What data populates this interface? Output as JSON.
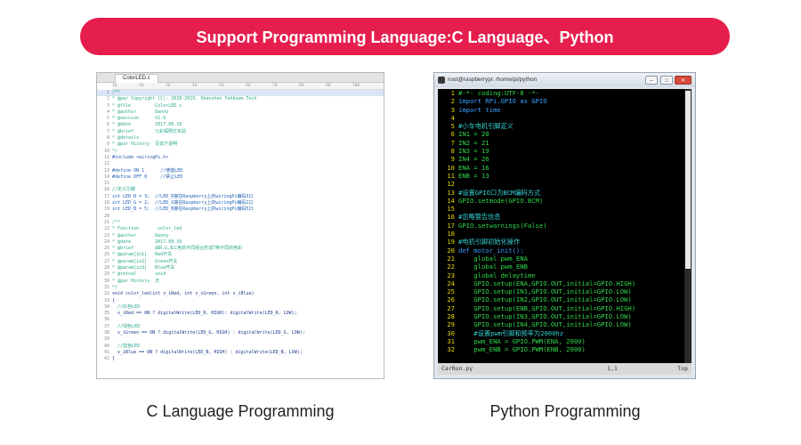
{
  "banner": {
    "title": "Support Programming Language:C Language、Python",
    "color": "#e61e4d"
  },
  "c_editor": {
    "tab": "ColorLED.c",
    "ruler": [
      "10",
      "20",
      "30",
      "40",
      "50",
      "60",
      "70",
      "80",
      "90",
      "100"
    ],
    "lines": [
      {
        "n": "1",
        "t": "/**",
        "type": "comment"
      },
      {
        "n": "2",
        "t": "* @par Copyright (C): 2010-2019, Shenzhen Yahboom Tech",
        "type": "comment"
      },
      {
        "n": "3",
        "t": "* @file         ColorLED.c",
        "type": "comment"
      },
      {
        "n": "4",
        "t": "* @author       Danny",
        "type": "comment"
      },
      {
        "n": "5",
        "t": "* @version      V1.0",
        "type": "comment"
      },
      {
        "n": "6",
        "t": "* @date         2017.08.16",
        "type": "comment"
      },
      {
        "n": "7",
        "t": "* @brief        七彩探照灯实验",
        "type": "comment"
      },
      {
        "n": "8",
        "t": "* @details",
        "type": "comment"
      },
      {
        "n": "9",
        "t": "* @par History  见如下说明",
        "type": "comment"
      },
      {
        "n": "10",
        "t": "*/",
        "type": "comment"
      },
      {
        "n": "11",
        "t": "#include <wiringPi.h>",
        "type": "directive"
      },
      {
        "n": "12",
        "t": "",
        "type": "plain"
      },
      {
        "n": "13",
        "t": "#define ON 1      //使能LED",
        "type": "define"
      },
      {
        "n": "14",
        "t": "#define OFF 0     //禁止LED",
        "type": "define"
      },
      {
        "n": "15",
        "t": "",
        "type": "plain"
      },
      {
        "n": "16",
        "t": "//定义引脚",
        "type": "comment"
      },
      {
        "n": "17",
        "t": "int LED_R = 3;  //LED_R接在Raspberry上的wiringPi编码3口",
        "type": "define"
      },
      {
        "n": "18",
        "t": "int LED_G = 2;  //LED_G接在Raspberry上的wiringPi编码2口",
        "type": "define"
      },
      {
        "n": "19",
        "t": "int LED_B = 5;  //LED_B接在Raspberry上的wiringPi编码5口",
        "type": "define"
      },
      {
        "n": "20",
        "t": "",
        "type": "plain"
      },
      {
        "n": "21",
        "t": "/**",
        "type": "comment"
      },
      {
        "n": "22",
        "t": "* Function       color_led",
        "type": "comment"
      },
      {
        "n": "23",
        "t": "* @author       Danny",
        "type": "comment"
      },
      {
        "n": "24",
        "t": "* @date         2017.08.16",
        "type": "comment"
      },
      {
        "n": "25",
        "t": "* @brief        由R,G,B三色的不同组合形成7种不同的色彩",
        "type": "comment"
      },
      {
        "n": "26",
        "t": "* @param[in1]   Red开关",
        "type": "comment"
      },
      {
        "n": "27",
        "t": "* @param[in2]   Green开关",
        "type": "comment"
      },
      {
        "n": "28",
        "t": "* @param[in3]   Blue开关",
        "type": "comment"
      },
      {
        "n": "29",
        "t": "* @retval       void",
        "type": "comment"
      },
      {
        "n": "30",
        "t": "* @par History  无",
        "type": "comment"
      },
      {
        "n": "31",
        "t": "*/",
        "type": "comment"
      },
      {
        "n": "32",
        "t": "void color_led(int v_iRed, int v_iGreen, int v_iBlue)",
        "type": "code"
      },
      {
        "n": "33",
        "t": "{",
        "type": "code"
      },
      {
        "n": "34",
        "t": "  //红色LED",
        "type": "comment"
      },
      {
        "n": "35",
        "t": "  v_iRed == ON ? digitalWrite(LED_R, HIGH): digitalWrite(LED_R, LOW);",
        "type": "code"
      },
      {
        "n": "36",
        "t": "",
        "type": "plain"
      },
      {
        "n": "37",
        "t": "  //绿色LED",
        "type": "comment"
      },
      {
        "n": "38",
        "t": "  v_iGreen == ON ? digitalWrite(LED_G, HIGH) : digitalWrite(LED_G, LOW);",
        "type": "code"
      },
      {
        "n": "39",
        "t": "",
        "type": "plain"
      },
      {
        "n": "40",
        "t": "  //蓝色LED",
        "type": "comment"
      },
      {
        "n": "41",
        "t": "  v_iBlue == ON ? digitalWrite(LED_B, HIGH) : digitalWrite(LED_B, LOW);",
        "type": "code"
      },
      {
        "n": "42",
        "t": "}",
        "type": "code"
      }
    ]
  },
  "py_terminal": {
    "title": "root@raspberrypi: /home/pi/python",
    "lines": [
      {
        "n": "1",
        "t": "#-*- coding:UTF-8 -*-",
        "type": "cursor"
      },
      {
        "n": "2",
        "t": "import RPi.GPIO as GPIO",
        "type": "keyword"
      },
      {
        "n": "3",
        "t": "import time",
        "type": "keyword"
      },
      {
        "n": "4",
        "t": "",
        "type": "code"
      },
      {
        "n": "5",
        "t": "#小车电机引脚定义",
        "type": "comment"
      },
      {
        "n": "6",
        "t": "IN1 = 20",
        "type": "code"
      },
      {
        "n": "7",
        "t": "IN2 = 21",
        "type": "code"
      },
      {
        "n": "8",
        "t": "IN3 = 19",
        "type": "code"
      },
      {
        "n": "9",
        "t": "IN4 = 26",
        "type": "code"
      },
      {
        "n": "10",
        "t": "ENA = 16",
        "type": "code"
      },
      {
        "n": "11",
        "t": "ENB = 13",
        "type": "code"
      },
      {
        "n": "12",
        "t": "",
        "type": "code"
      },
      {
        "n": "13",
        "t": "#设置GPIO口为BCM编码方式",
        "type": "comment"
      },
      {
        "n": "14",
        "t": "GPIO.setmode(GPIO.BCM)",
        "type": "code"
      },
      {
        "n": "15",
        "t": "",
        "type": "code"
      },
      {
        "n": "16",
        "t": "#忽略警告信息",
        "type": "comment"
      },
      {
        "n": "17",
        "t": "GPIO.setwarnings(False)",
        "type": "code"
      },
      {
        "n": "18",
        "t": "",
        "type": "code"
      },
      {
        "n": "19",
        "t": "#电机引脚初始化操作",
        "type": "comment"
      },
      {
        "n": "20",
        "t": "def motor_init():",
        "type": "keyword"
      },
      {
        "n": "21",
        "t": "    global pwm_ENA",
        "type": "code"
      },
      {
        "n": "22",
        "t": "    global pwm_ENB",
        "type": "code"
      },
      {
        "n": "23",
        "t": "    global delaytime",
        "type": "code"
      },
      {
        "n": "24",
        "t": "    GPIO.setup(ENA,GPIO.OUT,initial=GPIO.HIGH)",
        "type": "code"
      },
      {
        "n": "25",
        "t": "    GPIO.setup(IN1,GPIO.OUT,initial=GPIO.LOW)",
        "type": "code"
      },
      {
        "n": "26",
        "t": "    GPIO.setup(IN2,GPIO.OUT,initial=GPIO.LOW)",
        "type": "code"
      },
      {
        "n": "27",
        "t": "    GPIO.setup(ENB,GPIO.OUT,initial=GPIO.HIGH)",
        "type": "code"
      },
      {
        "n": "28",
        "t": "    GPIO.setup(IN3,GPIO.OUT,initial=GPIO.LOW)",
        "type": "code"
      },
      {
        "n": "29",
        "t": "    GPIO.setup(IN4,GPIO.OUT,initial=GPIO.LOW)",
        "type": "code"
      },
      {
        "n": "30",
        "t": "    #设置pwm引脚和频率为2000hz",
        "type": "comment"
      },
      {
        "n": "31",
        "t": "    pwm_ENA = GPIO.PWM(ENA, 2000)",
        "type": "code"
      },
      {
        "n": "32",
        "t": "    pwm_ENB = GPIO.PWM(ENB, 2000)",
        "type": "code"
      }
    ],
    "status": {
      "file": "CarRun.py",
      "position": "1,1",
      "scroll": "Top"
    }
  },
  "captions": {
    "left": "C Language Programming",
    "right": "Python Programming"
  }
}
